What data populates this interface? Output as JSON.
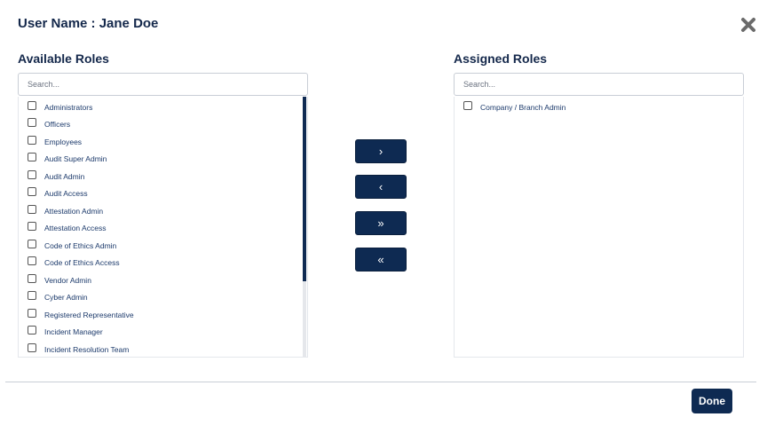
{
  "dialog": {
    "title": "User Name : Jane Doe",
    "close_icon": "close-x-icon"
  },
  "available": {
    "heading": "Available Roles",
    "search_placeholder": "Search...",
    "items": [
      {
        "label": "Administrators",
        "checked": false
      },
      {
        "label": "Officers",
        "checked": false
      },
      {
        "label": "Employees",
        "checked": false
      },
      {
        "label": "Audit Super Admin",
        "checked": false
      },
      {
        "label": "Audit Admin",
        "checked": false
      },
      {
        "label": "Audit Access",
        "checked": false
      },
      {
        "label": "Attestation Admin",
        "checked": false
      },
      {
        "label": "Attestation Access",
        "checked": false
      },
      {
        "label": "Code of Ethics Admin",
        "checked": false
      },
      {
        "label": "Code of Ethics Access",
        "checked": false
      },
      {
        "label": "Vendor Admin",
        "checked": false
      },
      {
        "label": "Cyber Admin",
        "checked": false
      },
      {
        "label": "Registered Representative",
        "checked": false
      },
      {
        "label": "Incident Manager",
        "checked": false
      },
      {
        "label": "Incident Resolution Team",
        "checked": false
      }
    ]
  },
  "assigned": {
    "heading": "Assigned Roles",
    "search_placeholder": "Search...",
    "items": [
      {
        "label": "Company / Branch Admin",
        "checked": false
      }
    ]
  },
  "transfer_buttons": {
    "move_right": "›",
    "move_left": "‹",
    "move_all_right": "»",
    "move_all_left": "«"
  },
  "footer": {
    "done_label": "Done"
  },
  "colors": {
    "primary": "#0e2a52",
    "heading": "#14284b",
    "item_text": "#1c3a6b"
  }
}
